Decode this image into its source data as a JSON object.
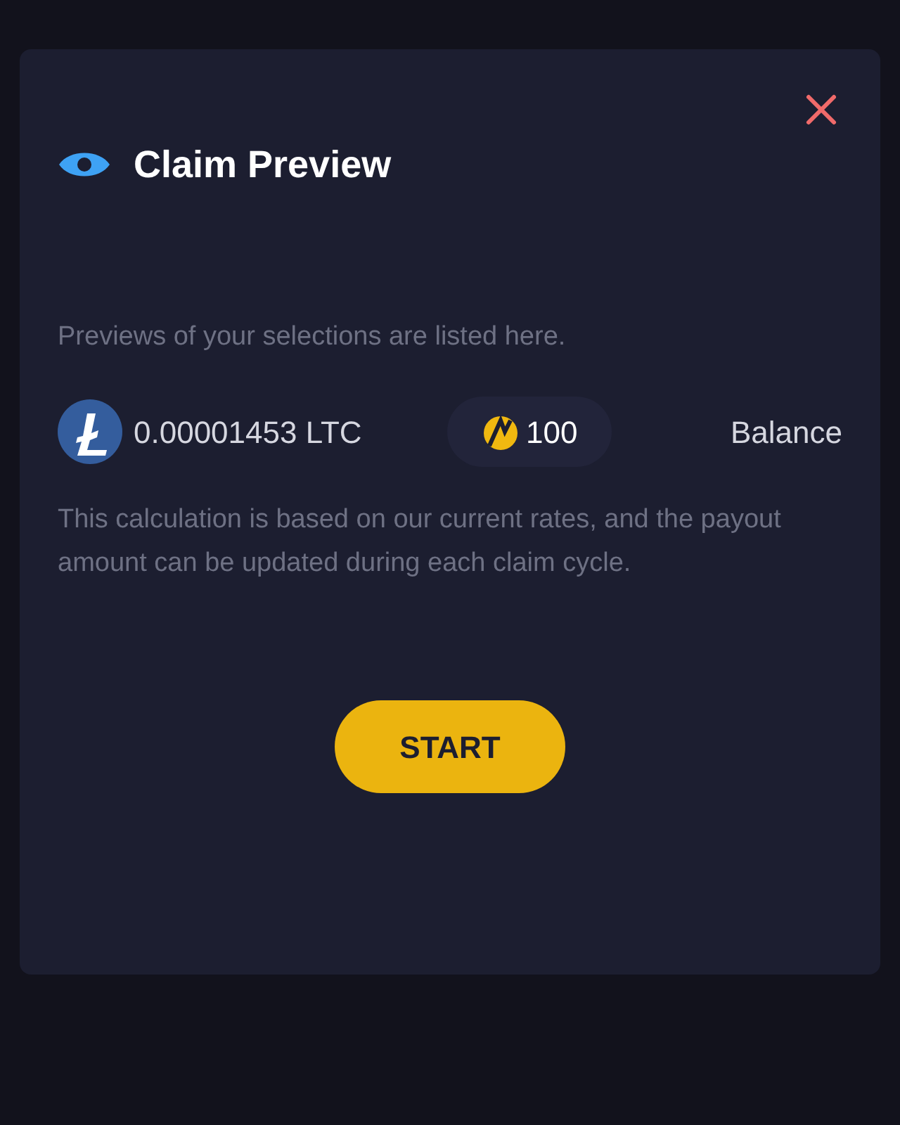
{
  "dialog": {
    "title": "Claim Preview",
    "intro": "Previews of your selections are listed here.",
    "amount": "0.00001453 LTC",
    "points": "100",
    "balance_label": "Balance",
    "note": "This calculation is based on our current rates, and the payout amount can be updated during each claim cycle.",
    "button": "START"
  }
}
